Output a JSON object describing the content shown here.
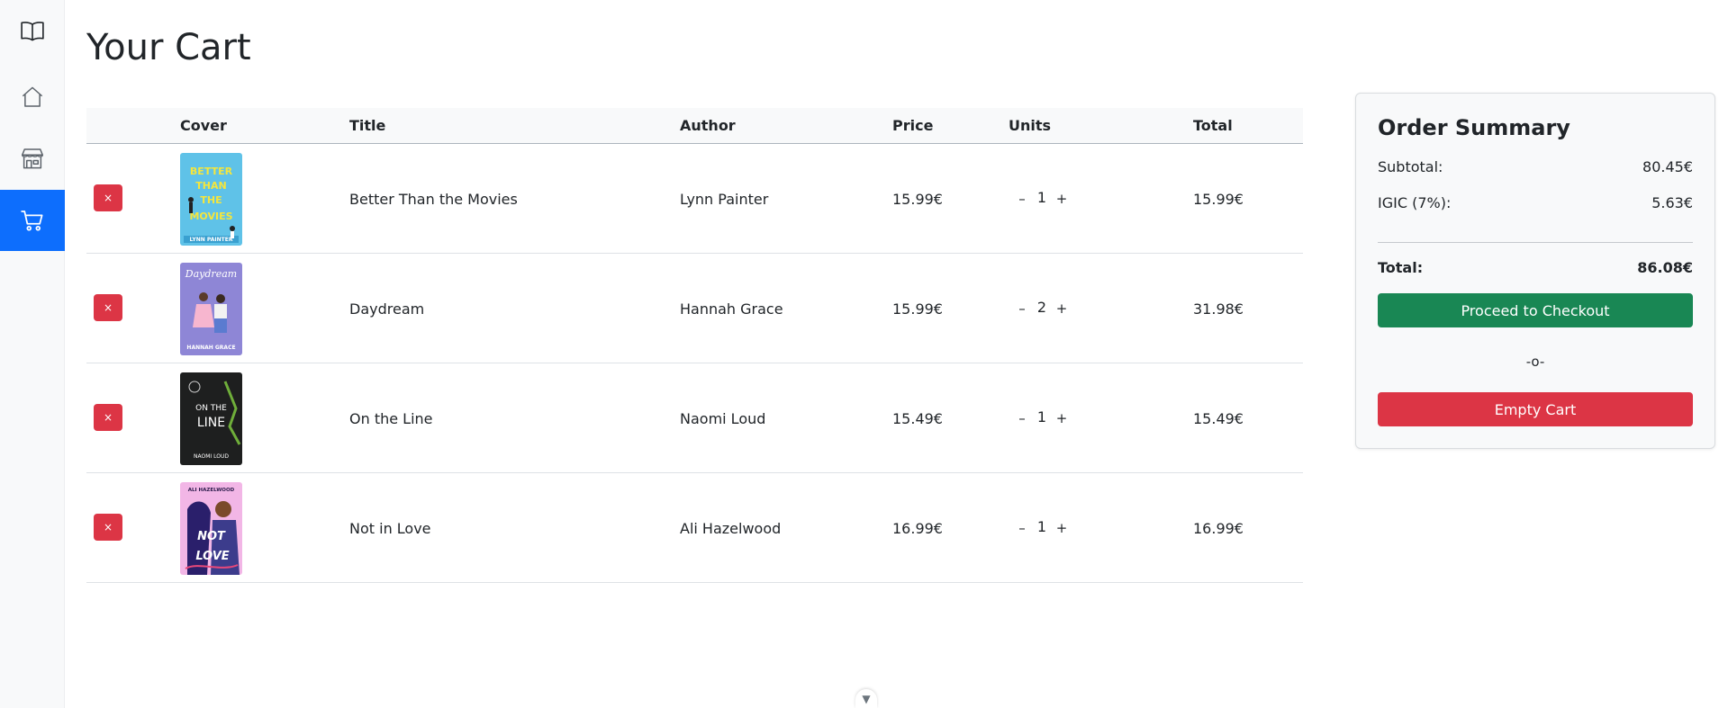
{
  "sidebar": {
    "items": [
      {
        "icon": "book-icon"
      },
      {
        "icon": "home-icon"
      },
      {
        "icon": "store-icon"
      },
      {
        "icon": "cart-icon",
        "active": true
      }
    ],
    "active_color": "#0d6efd"
  },
  "page": {
    "title": "Your Cart"
  },
  "table": {
    "headers": [
      "Cover",
      "Title",
      "Author",
      "Price",
      "Units",
      "Total"
    ],
    "remove_label": "×",
    "minus_label": "–",
    "plus_label": "+",
    "rows": [
      {
        "title": "Better Than the Movies",
        "author": "Lynn Painter",
        "price": "15.99€",
        "units": "1",
        "total": "15.99€",
        "cover_text": "BETTER THAN THE MOVIES",
        "cover_author": "LYNN PAINTER"
      },
      {
        "title": "Daydream",
        "author": "Hannah Grace",
        "price": "15.99€",
        "units": "2",
        "total": "31.98€",
        "cover_text": "Daydream",
        "cover_author": "HANNAH GRACE"
      },
      {
        "title": "On the Line",
        "author": "Naomi Loud",
        "price": "15.49€",
        "units": "1",
        "total": "15.49€",
        "cover_text": "ON THE LINE",
        "cover_author": "NAOMI LOUD"
      },
      {
        "title": "Not in Love",
        "author": "Ali Hazelwood",
        "price": "16.99€",
        "units": "1",
        "total": "16.99€",
        "cover_text": "NOT IN LOVE",
        "cover_author": "ALI HAZELWOOD"
      }
    ]
  },
  "summary": {
    "title": "Order Summary",
    "subtotal_label": "Subtotal:",
    "subtotal_value": "80.45€",
    "tax_label": "IGIC (7%):",
    "tax_value": "5.63€",
    "total_label": "Total:",
    "total_value": "86.08€",
    "checkout_label": "Proceed to Checkout",
    "or_label": "-o-",
    "empty_label": "Empty Cart",
    "checkout_color": "#198754",
    "empty_color": "#dc3545"
  },
  "scroll": {
    "icon": "chevron-down-icon",
    "glyph": "▼"
  }
}
